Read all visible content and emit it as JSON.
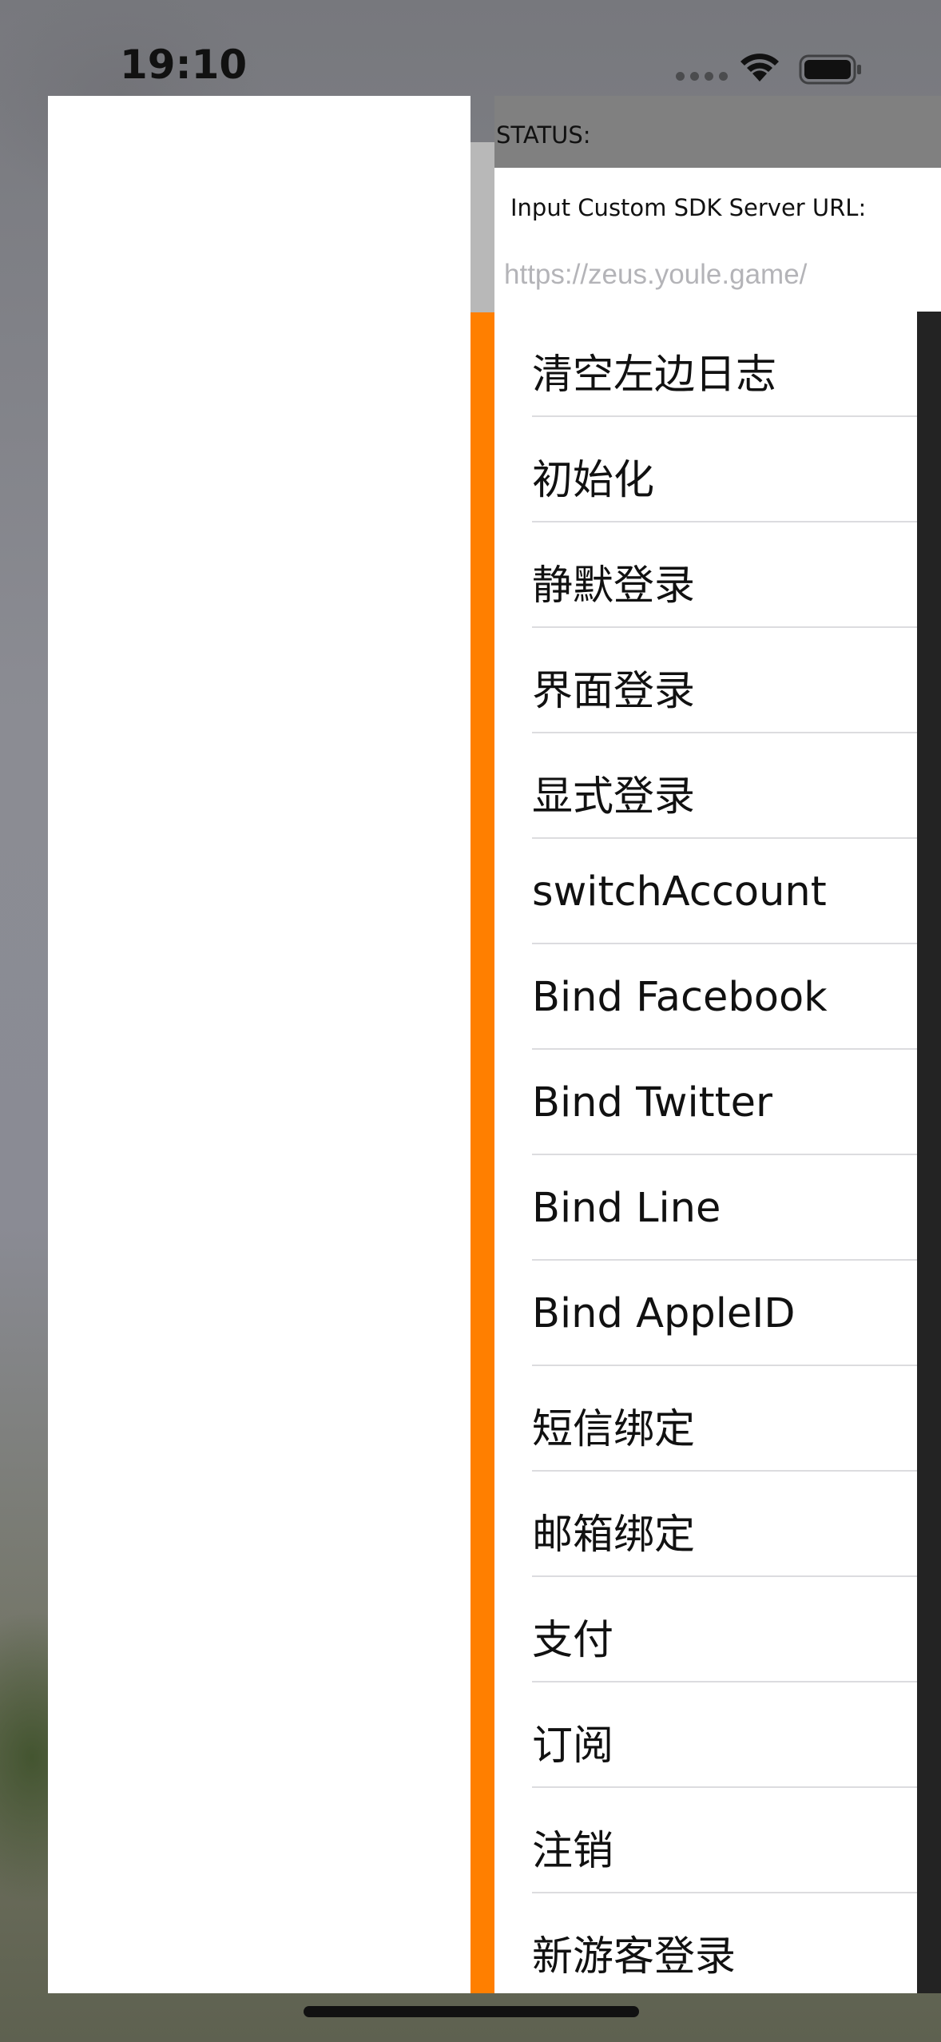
{
  "status_bar": {
    "time": "19:10",
    "icons": [
      "cellular-signal-icon",
      "wifi-icon",
      "battery-icon"
    ]
  },
  "status": {
    "label": "STATUS:"
  },
  "server_url": {
    "label": "Input Custom SDK Server URL:",
    "value": "",
    "placeholder": "https://zeus.youle.game/"
  },
  "menu": {
    "items": [
      {
        "label": "清空左边日志"
      },
      {
        "label": "初始化"
      },
      {
        "label": "静默登录"
      },
      {
        "label": "界面登录"
      },
      {
        "label": "显式登录"
      },
      {
        "label": "switchAccount"
      },
      {
        "label": "Bind Facebook"
      },
      {
        "label": "Bind Twitter"
      },
      {
        "label": "Bind Line"
      },
      {
        "label": "Bind AppleID"
      },
      {
        "label": "短信绑定"
      },
      {
        "label": "邮箱绑定"
      },
      {
        "label": "支付"
      },
      {
        "label": "订阅"
      },
      {
        "label": "注销"
      },
      {
        "label": "新游客登录"
      }
    ]
  },
  "colors": {
    "accent_strip": "#ff7f00",
    "status_header_bg": "#808080",
    "separator": "#dcdcdf",
    "placeholder_text": "#b4b4b8"
  }
}
